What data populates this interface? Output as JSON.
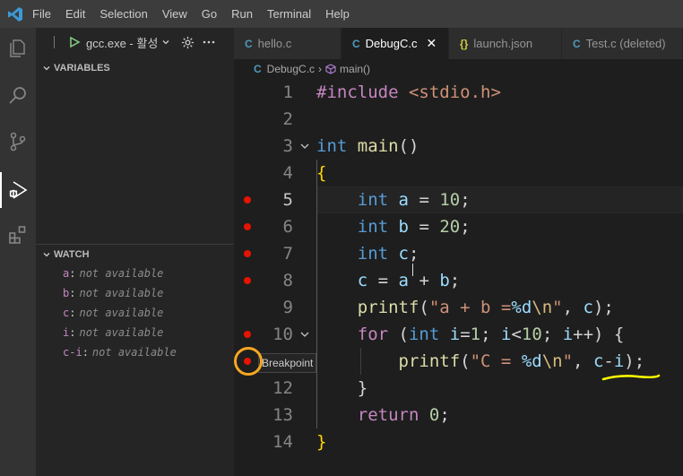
{
  "menu": [
    "File",
    "Edit",
    "Selection",
    "View",
    "Go",
    "Run",
    "Terminal",
    "Help"
  ],
  "debug": {
    "config_label": "gcc.exe - 활성"
  },
  "sections": {
    "variables": "VARIABLES",
    "watch": "WATCH"
  },
  "watch": [
    {
      "name": "a",
      "value": "not available"
    },
    {
      "name": "b",
      "value": "not available"
    },
    {
      "name": "c",
      "value": "not available"
    },
    {
      "name": "i",
      "value": "not available"
    },
    {
      "name": "c-i",
      "value": "not available"
    }
  ],
  "tabs": [
    {
      "label": "hello.c",
      "icon": "C",
      "active": false
    },
    {
      "label": "DebugC.c",
      "icon": "C",
      "active": true
    },
    {
      "label": "launch.json",
      "icon": "{}",
      "active": false
    },
    {
      "label": "Test.c (deleted)",
      "icon": "C",
      "active": false
    }
  ],
  "breadcrumb": {
    "file": "DebugC.c",
    "symbol": "main()"
  },
  "code": [
    {
      "n": "1",
      "bp": false,
      "fold": false
    },
    {
      "n": "2",
      "bp": false,
      "fold": false
    },
    {
      "n": "3",
      "bp": false,
      "fold": true
    },
    {
      "n": "4",
      "bp": false,
      "fold": false
    },
    {
      "n": "5",
      "bp": true,
      "fold": false
    },
    {
      "n": "6",
      "bp": true,
      "fold": false
    },
    {
      "n": "7",
      "bp": true,
      "fold": false
    },
    {
      "n": "8",
      "bp": true,
      "fold": false
    },
    {
      "n": "9",
      "bp": false,
      "fold": false
    },
    {
      "n": "10",
      "bp": true,
      "fold": true
    },
    {
      "n": "11",
      "bp": true,
      "fold": false
    },
    {
      "n": "12",
      "bp": false,
      "fold": false
    },
    {
      "n": "13",
      "bp": false,
      "fold": false
    },
    {
      "n": "14",
      "bp": false,
      "fold": false
    }
  ],
  "tooltip": "Breakpoint",
  "colors": {
    "breakpoint": "#e51400",
    "annotation": "#f5a623",
    "underline": "#ffff00"
  }
}
